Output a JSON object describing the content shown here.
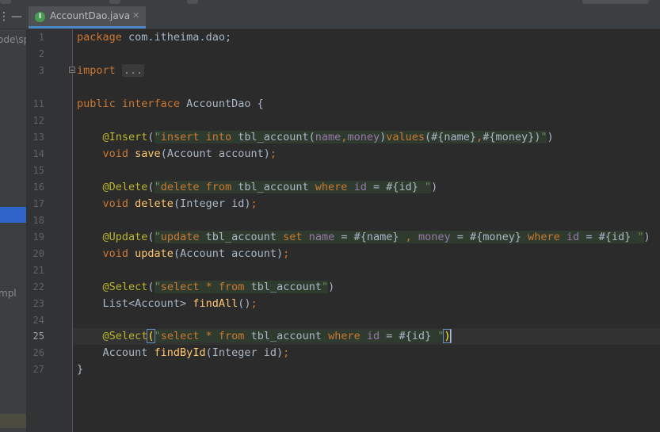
{
  "editor": {
    "active_tab": "AccountDao.java",
    "tab_file_icon_letter": "I",
    "current_line": "25",
    "lines": [
      {
        "no": "1",
        "text": "package com.itheima.dao;"
      },
      {
        "no": "2",
        "text": ""
      },
      {
        "no": "3",
        "text": "import ..."
      },
      {
        "no": "11",
        "text": "public interface AccountDao {"
      },
      {
        "no": "12",
        "text": ""
      },
      {
        "no": "13",
        "text": "    @Insert(\"insert into tbl_account(name,money)values(#{name},#{money})\")"
      },
      {
        "no": "14",
        "text": "    void save(Account account);"
      },
      {
        "no": "15",
        "text": ""
      },
      {
        "no": "16",
        "text": "    @Delete(\"delete from tbl_account where id = #{id} \")"
      },
      {
        "no": "17",
        "text": "    void delete(Integer id);"
      },
      {
        "no": "18",
        "text": ""
      },
      {
        "no": "19",
        "text": "    @Update(\"update tbl_account set name = #{name} , money = #{money} where id = #{id} \")"
      },
      {
        "no": "20",
        "text": "    void update(Account account);"
      },
      {
        "no": "21",
        "text": ""
      },
      {
        "no": "22",
        "text": "    @Select(\"select * from tbl_account\")"
      },
      {
        "no": "23",
        "text": "    List<Account> findAll();"
      },
      {
        "no": "24",
        "text": ""
      },
      {
        "no": "25",
        "text": "    @Select(\"select * from tbl_account where id = #{id} \")"
      },
      {
        "no": "26",
        "text": "    Account findById(Integer id);"
      },
      {
        "no": "27",
        "text": "}"
      }
    ]
  },
  "project_panel": {
    "visible_fragments": [
      "ode\\sp",
      "mpl"
    ]
  },
  "colors": {
    "background": "#2b2b2b",
    "keyword": "#cc7832",
    "annotation": "#bbb529",
    "string": "#6a8759",
    "method": "#ffc66d",
    "field": "#9876aa",
    "selection": "#2f65ca"
  }
}
